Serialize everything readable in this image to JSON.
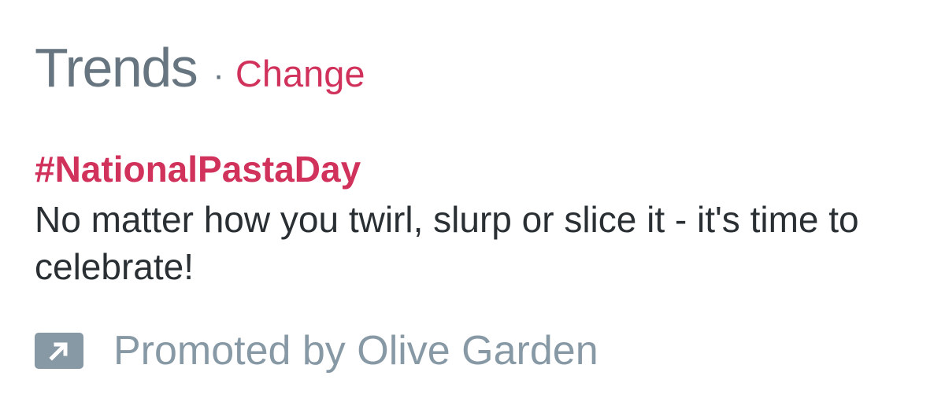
{
  "module": {
    "title": "Trends",
    "separator": "·",
    "change_label": "Change"
  },
  "trend": {
    "name": "#NationalPastaDay",
    "description": "No matter how you twirl, slurp or slice it - it's time to celebrate!",
    "promoted_text": "Promoted by Olive Garden",
    "promoted_icon": "promoted-arrow-icon"
  },
  "colors": {
    "accent": "#d1325c",
    "title_gray": "#66757f",
    "body_text": "#292f33",
    "promoted_gray": "#8899a6"
  }
}
